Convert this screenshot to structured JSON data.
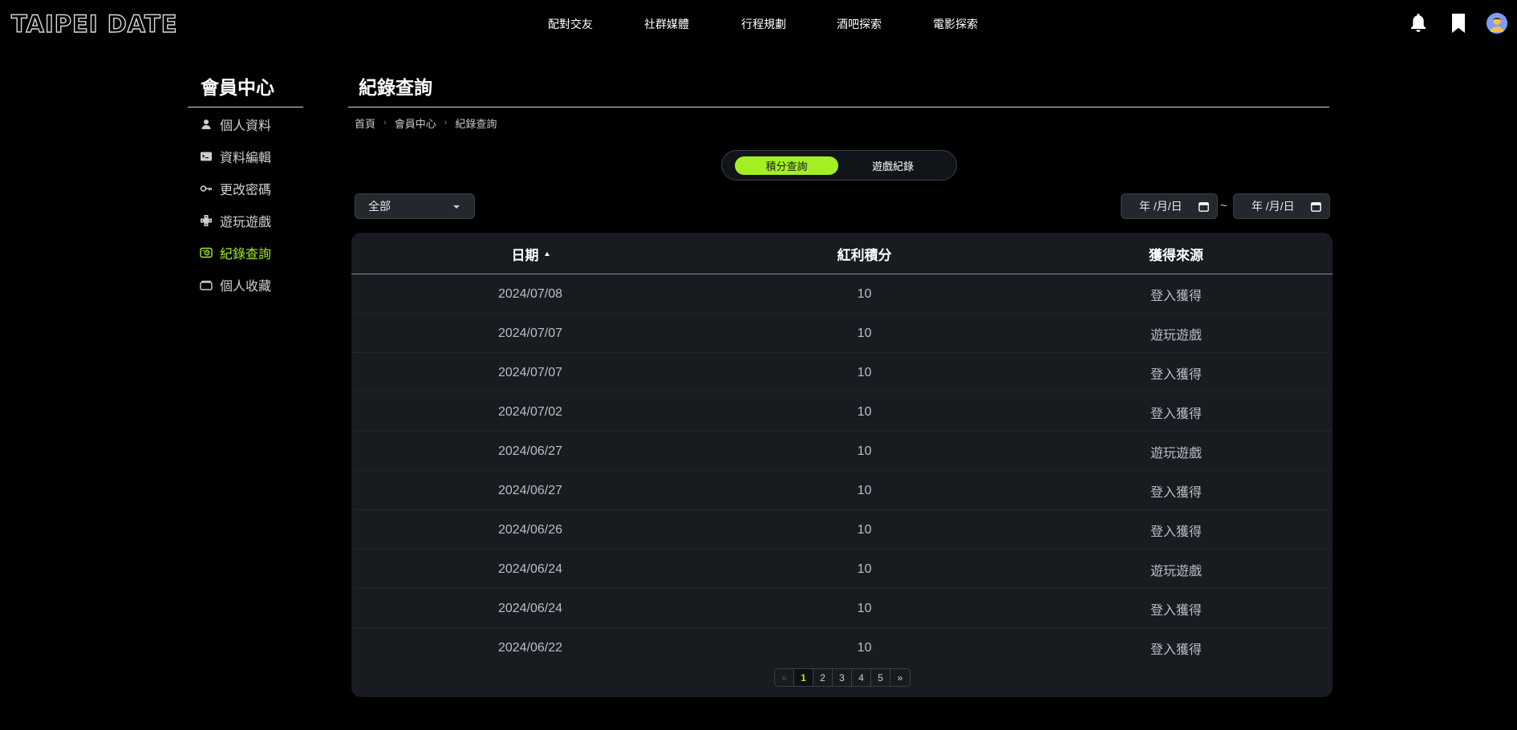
{
  "header": {
    "logo": "TAIPEI DATE",
    "nav": [
      "配對交友",
      "社群媒體",
      "行程規劃",
      "酒吧探索",
      "電影探索"
    ],
    "icons": [
      "bell-icon",
      "bookmark-icon",
      "avatar"
    ]
  },
  "sidebar": {
    "title": "會員中心",
    "items": [
      {
        "label": "個人資料",
        "icon": "person-icon"
      },
      {
        "label": "資料編輯",
        "icon": "terminal-icon"
      },
      {
        "label": "更改密碼",
        "icon": "key-icon"
      },
      {
        "label": "遊玩遊戲",
        "icon": "gamepad-icon"
      },
      {
        "label": "紀錄查詢",
        "icon": "record-icon",
        "active": true
      },
      {
        "label": "個人收藏",
        "icon": "folder-icon"
      }
    ]
  },
  "main": {
    "title": "紀錄查詢",
    "breadcrumb": [
      "首頁",
      "會員中心",
      "紀錄查詢"
    ],
    "tabs": [
      {
        "label": "積分查詢",
        "active": true
      },
      {
        "label": "遊戲紀錄",
        "active": false
      }
    ],
    "filter": {
      "selected": "全部"
    },
    "date_from": "年 /月/日",
    "date_to": "年 /月/日",
    "date_separator": "~"
  },
  "table": {
    "headers": [
      "日期",
      "紅利積分",
      "獲得來源"
    ],
    "rows": [
      [
        "2024/07/08",
        "10",
        "登入獲得"
      ],
      [
        "2024/07/07",
        "10",
        "遊玩遊戲"
      ],
      [
        "2024/07/07",
        "10",
        "登入獲得"
      ],
      [
        "2024/07/02",
        "10",
        "登入獲得"
      ],
      [
        "2024/06/27",
        "10",
        "遊玩遊戲"
      ],
      [
        "2024/06/27",
        "10",
        "登入獲得"
      ],
      [
        "2024/06/26",
        "10",
        "登入獲得"
      ],
      [
        "2024/06/24",
        "10",
        "遊玩遊戲"
      ],
      [
        "2024/06/24",
        "10",
        "登入獲得"
      ],
      [
        "2024/06/22",
        "10",
        "登入獲得"
      ]
    ]
  },
  "pagination": {
    "prev": "«",
    "pages": [
      "1",
      "2",
      "3",
      "4",
      "5"
    ],
    "current": "1",
    "next": "»"
  },
  "colors": {
    "accent": "#a3ef23",
    "background": "#000000",
    "card": "#181b20"
  }
}
